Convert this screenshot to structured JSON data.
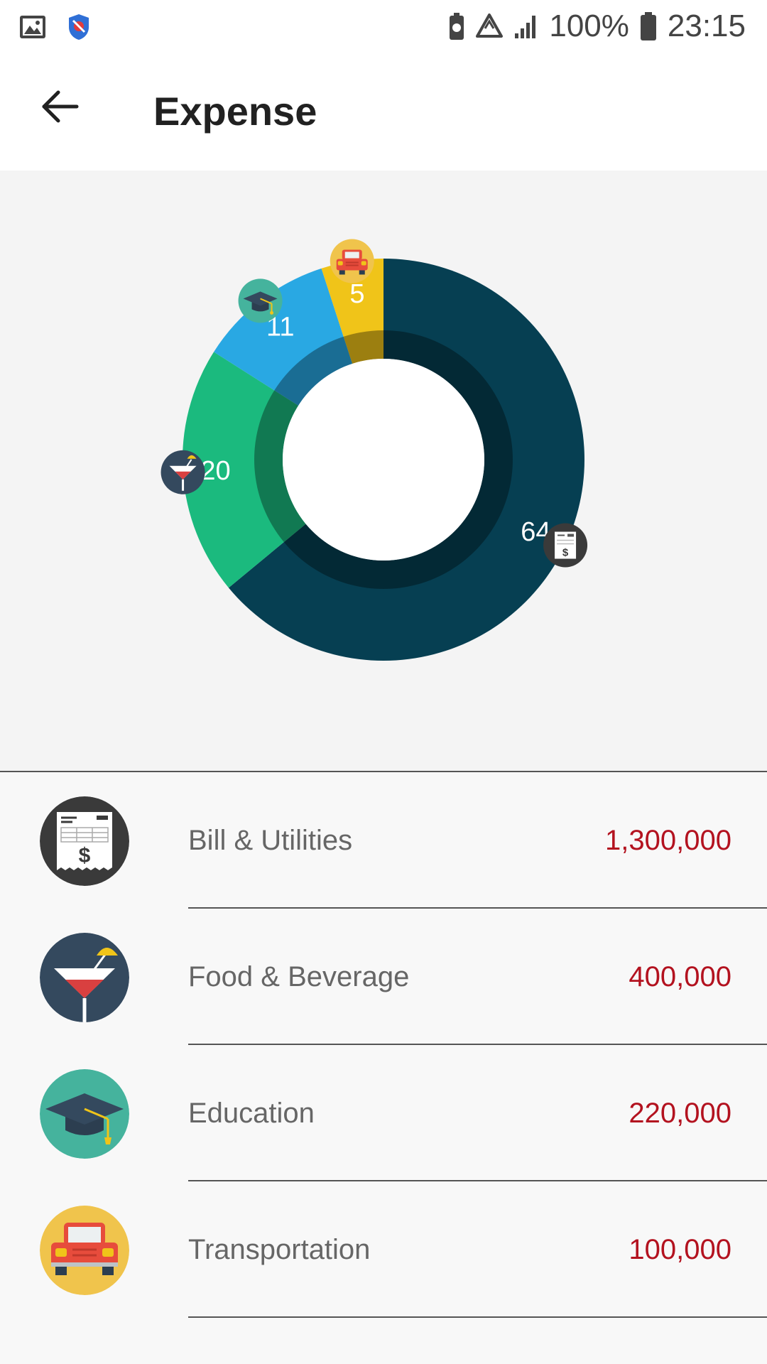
{
  "status_bar": {
    "battery_percent": "100%",
    "time": "23:15",
    "icons": [
      "gallery-icon",
      "shield-icon",
      "battery-saver-icon",
      "recycle-icon",
      "signal-icon",
      "battery-icon"
    ]
  },
  "app_bar": {
    "title": "Expense",
    "back_icon": "arrow-left-icon"
  },
  "chart_data": {
    "type": "pie",
    "donut": true,
    "categories": [
      "Bill & Utilities",
      "Food & Beverage",
      "Education",
      "Transportation"
    ],
    "values": [
      64,
      20,
      11,
      5
    ],
    "colors": [
      "#063f52",
      "#1bba7e",
      "#29a8e3",
      "#f0c419"
    ],
    "icons": [
      "bill-icon",
      "cocktail-icon",
      "graduation-cap-icon",
      "car-icon"
    ]
  },
  "expenses": [
    {
      "label": "Bill & Utilities",
      "amount": "1,300,000",
      "icon": "bill-icon"
    },
    {
      "label": "Food & Beverage",
      "amount": "400,000",
      "icon": "cocktail-icon"
    },
    {
      "label": "Education",
      "amount": "220,000",
      "icon": "graduation-cap-icon"
    },
    {
      "label": "Transportation",
      "amount": "100,000",
      "icon": "car-icon"
    }
  ]
}
